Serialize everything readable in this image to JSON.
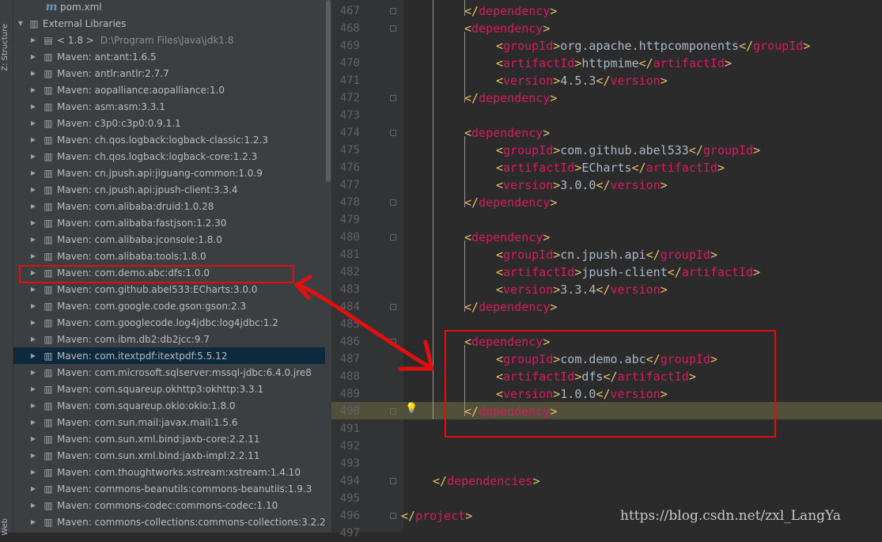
{
  "side_tabs": {
    "structure": "Z: Structure",
    "web": "Web"
  },
  "tree": {
    "pom": "pom.xml",
    "external_libraries": "External Libraries",
    "jdk_name": "< 1.8 >",
    "jdk_path": "D:\\Program Files\\Java\\jdk1.8",
    "libraries": [
      "Maven: ant:ant:1.6.5",
      "Maven: antlr:antlr:2.7.7",
      "Maven: aopalliance:aopalliance:1.0",
      "Maven: asm:asm:3.3.1",
      "Maven: c3p0:c3p0:0.9.1.1",
      "Maven: ch.qos.logback:logback-classic:1.2.3",
      "Maven: ch.qos.logback:logback-core:1.2.3",
      "Maven: cn.jpush.api:jiguang-common:1.0.9",
      "Maven: cn.jpush.api:jpush-client:3.3.4",
      "Maven: com.alibaba:druid:1.0.28",
      "Maven: com.alibaba:fastjson:1.2.30",
      "Maven: com.alibaba:jconsole:1.8.0",
      "Maven: com.alibaba:tools:1.8.0",
      "Maven: com.demo.abc:dfs:1.0.0",
      "Maven: com.github.abel533:ECharts:3.0.0",
      "Maven: com.google.code.gson:gson:2.3",
      "Maven: com.googlecode.log4jdbc:log4jdbc:1.2",
      "Maven: com.ibm.db2:db2jcc:9.7",
      "Maven: com.itextpdf:itextpdf:5.5.12",
      "Maven: com.microsoft.sqlserver:mssql-jdbc:6.4.0.jre8",
      "Maven: com.squareup.okhttp3:okhttp:3.3.1",
      "Maven: com.squareup.okio:okio:1.8.0",
      "Maven: com.sun.mail:javax.mail:1.5.6",
      "Maven: com.sun.xml.bind:jaxb-core:2.2.11",
      "Maven: com.sun.xml.bind:jaxb-impl:2.2.11",
      "Maven: com.thoughtworks.xstream:xstream:1.4.10",
      "Maven: commons-beanutils:commons-beanutils:1.9.3",
      "Maven: commons-codec:commons-codec:1.10",
      "Maven: commons-collections:commons-collections:3.2.2"
    ],
    "selected_index": 18,
    "highlighted_index": 13
  },
  "editor": {
    "lines": [
      {
        "n": "467",
        "text": "</dependency>",
        "indent": 2
      },
      {
        "n": "468",
        "text": "<dependency>",
        "indent": 2
      },
      {
        "n": "469",
        "text": "<groupId>org.apache.httpcomponents</groupId>",
        "indent": 3
      },
      {
        "n": "470",
        "text": "<artifactId>httpmime</artifactId>",
        "indent": 3
      },
      {
        "n": "471",
        "text": "<version>4.5.3</version>",
        "indent": 3
      },
      {
        "n": "472",
        "text": "</dependency>",
        "indent": 2
      },
      {
        "n": "473",
        "text": "",
        "indent": 0
      },
      {
        "n": "474",
        "text": "<dependency>",
        "indent": 2
      },
      {
        "n": "475",
        "text": "<groupId>com.github.abel533</groupId>",
        "indent": 3
      },
      {
        "n": "476",
        "text": "<artifactId>ECharts</artifactId>",
        "indent": 3
      },
      {
        "n": "477",
        "text": "<version>3.0.0</version>",
        "indent": 3
      },
      {
        "n": "478",
        "text": "</dependency>",
        "indent": 2
      },
      {
        "n": "479",
        "text": "",
        "indent": 0
      },
      {
        "n": "480",
        "text": "<dependency>",
        "indent": 2
      },
      {
        "n": "481",
        "text": "<groupId>cn.jpush.api</groupId>",
        "indent": 3
      },
      {
        "n": "482",
        "text": "<artifactId>jpush-client</artifactId>",
        "indent": 3
      },
      {
        "n": "483",
        "text": "<version>3.3.4</version>",
        "indent": 3
      },
      {
        "n": "484",
        "text": "</dependency>",
        "indent": 2
      },
      {
        "n": "485",
        "text": "",
        "indent": 0
      },
      {
        "n": "486",
        "text": "<dependency>",
        "indent": 2
      },
      {
        "n": "487",
        "text": "<groupId>com.demo.abc</groupId>",
        "indent": 3
      },
      {
        "n": "488",
        "text": "<artifactId>dfs</artifactId>",
        "indent": 3
      },
      {
        "n": "489",
        "text": "<version>1.0.0</version>",
        "indent": 3
      },
      {
        "n": "490",
        "text": "</dependency>",
        "indent": 2
      },
      {
        "n": "491",
        "text": "",
        "indent": 0
      },
      {
        "n": "492",
        "text": "",
        "indent": 0
      },
      {
        "n": "493",
        "text": "",
        "indent": 0
      },
      {
        "n": "494",
        "text": "</dependencies>",
        "indent": 1
      },
      {
        "n": "495",
        "text": "",
        "indent": 0
      },
      {
        "n": "496",
        "text": "</project>",
        "indent": 0
      },
      {
        "n": "497",
        "text": "",
        "indent": 0
      }
    ],
    "current_line": "490"
  },
  "watermark": "https://blog.csdn.net/zxl_LangYa",
  "colors": {
    "tag_bracket": "#e8bf6a",
    "tag_name": "#d81b60",
    "text": "#a9b7c6",
    "annotation": "#e01010"
  }
}
